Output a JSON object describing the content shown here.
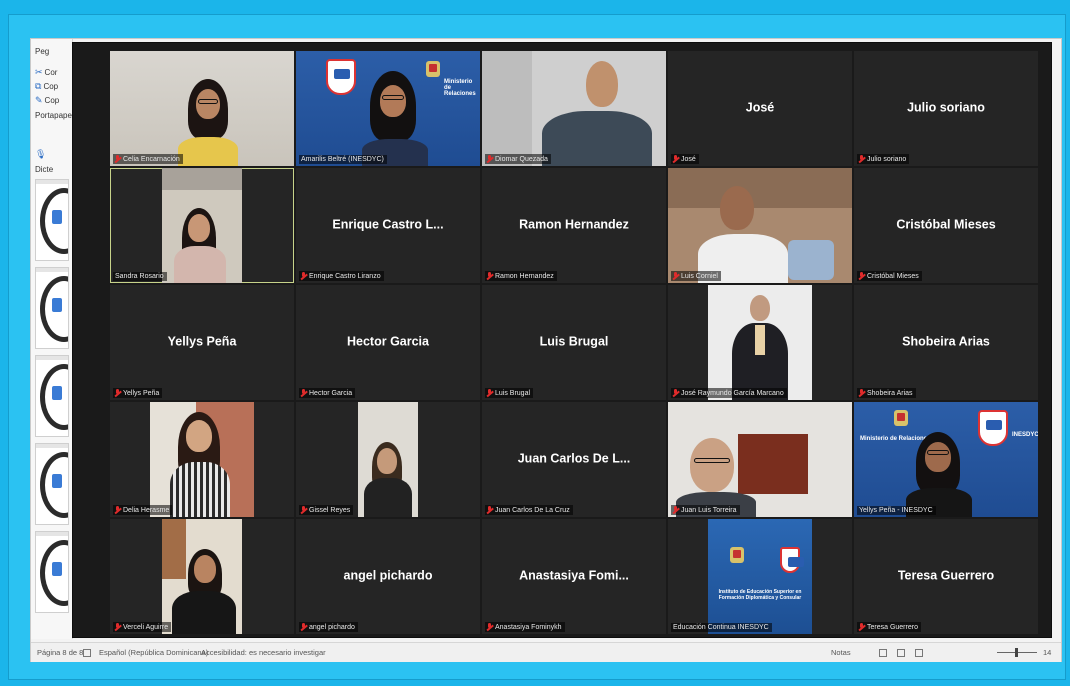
{
  "word": {
    "ribbon": {
      "paste_group": "Portapape",
      "cut": "Cor",
      "copy": "Cop",
      "copy_format": "Cop",
      "dictate": "Dicte",
      "misc": "Peg"
    },
    "status": {
      "page": "Página 8 de 8",
      "language": "Español (República Dominicana)",
      "accessibility": "Accesibilidad: es necesario investigar",
      "notes": "Notas",
      "zoom": "14"
    }
  },
  "participants": [
    {
      "label": "Celia Encarnación",
      "muted": true,
      "video": "woman-a"
    },
    {
      "label": "Amarilis Beltré (INESDYC)",
      "muted": false,
      "video": "woman-logo"
    },
    {
      "label": "Diomar Quezada",
      "muted": true,
      "video": "man-a"
    },
    {
      "label": "José",
      "display_name": "José",
      "muted": true,
      "video": null
    },
    {
      "label": "Julio soriano",
      "display_name": "Julio soriano",
      "muted": true,
      "video": null
    },
    {
      "label": "Sandra Rosario",
      "muted": false,
      "video": "woman-car",
      "active": true
    },
    {
      "label": "Enrique Castro Liranzo",
      "display_name": "Enrique Castro L...",
      "muted": true,
      "video": null
    },
    {
      "label": "Ramon Hernandez",
      "display_name": "Ramon Hernandez",
      "muted": true,
      "video": null
    },
    {
      "label": "Luis Corniel",
      "muted": true,
      "video": "man-phone"
    },
    {
      "label": "Cristóbal Mieses",
      "display_name": "Cristóbal Mieses",
      "muted": true,
      "video": null
    },
    {
      "label": "Yellys Peña",
      "display_name": "Yellys Peña",
      "muted": true,
      "video": null
    },
    {
      "label": "Hector Garcia",
      "display_name": "Hector Garcia",
      "muted": true,
      "video": null
    },
    {
      "label": "Luis Brugal",
      "display_name": "Luis Brugal",
      "muted": true,
      "video": null
    },
    {
      "label": "José Raymundo García Marcano",
      "muted": true,
      "video": "man-suit"
    },
    {
      "label": "Shobeira Arias",
      "display_name": "Shobeira Arias",
      "muted": true,
      "video": null
    },
    {
      "label": "Delia Herasme",
      "muted": true,
      "video": "woman-brick"
    },
    {
      "label": "Gissel Reyes",
      "muted": true,
      "video": "woman-room"
    },
    {
      "label": "Juan Carlos De La Cruz",
      "display_name": "Juan Carlos De L...",
      "muted": true,
      "video": null
    },
    {
      "label": "Juan Luis Torreira",
      "muted": true,
      "video": "man-art"
    },
    {
      "label": "Yellys Peña - INESDYC",
      "muted": false,
      "video": "woman-logo2"
    },
    {
      "label": "Verceli Aguirre",
      "muted": true,
      "video": "woman-window"
    },
    {
      "label": "angel pichardo",
      "display_name": "angel pichardo",
      "muted": true,
      "video": null
    },
    {
      "label": "Anastasiya Fominykh",
      "display_name": "Anastasiya  Fomi...",
      "muted": true,
      "video": null
    },
    {
      "label": "Educación Continua INESDYC",
      "muted": false,
      "video": "slide"
    },
    {
      "label": "Teresa Guerrero",
      "display_name": "Teresa Guerrero",
      "muted": true,
      "video": null
    }
  ],
  "logo_text": {
    "inesdyc": "INESDYC",
    "ministerio": "Ministerio de Relaciones",
    "slide_title": "Instituto de Educación Superior en Formación Diplomática y Consular"
  },
  "colors": {
    "outer_frame": "#1bb5ea",
    "zoom_bg": "#1a1a1a",
    "tile_bg": "#252525",
    "muted_icon": "#e02b2b",
    "active_speaker_border": "#c7d38a"
  }
}
